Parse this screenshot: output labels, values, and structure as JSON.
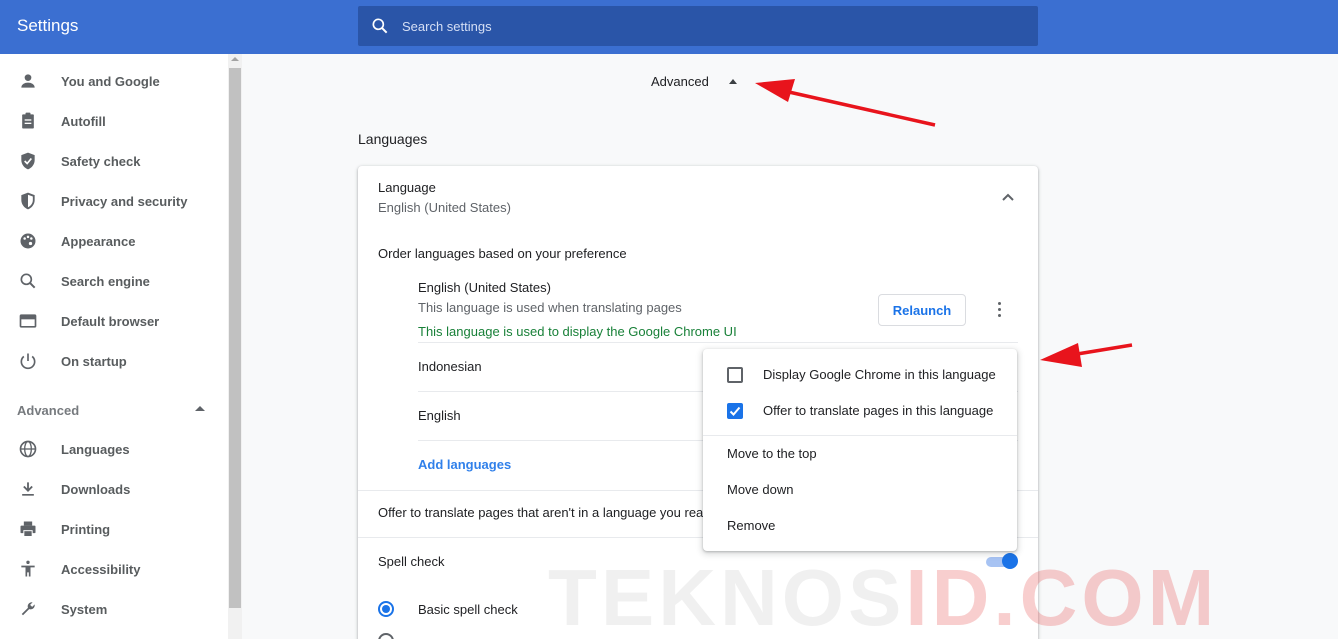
{
  "header": {
    "title": "Settings",
    "search_placeholder": "Search settings"
  },
  "sidebar": {
    "items": [
      {
        "label": "You and Google",
        "icon": "person-icon"
      },
      {
        "label": "Autofill",
        "icon": "clipboard-icon"
      },
      {
        "label": "Safety check",
        "icon": "shield-check-icon"
      },
      {
        "label": "Privacy and security",
        "icon": "shield-icon"
      },
      {
        "label": "Appearance",
        "icon": "palette-icon"
      },
      {
        "label": "Search engine",
        "icon": "search-icon"
      },
      {
        "label": "Default browser",
        "icon": "browser-icon"
      },
      {
        "label": "On startup",
        "icon": "power-icon"
      }
    ],
    "advanced_label": "Advanced",
    "advanced_items": [
      {
        "label": "Languages",
        "icon": "globe-icon"
      },
      {
        "label": "Downloads",
        "icon": "download-icon"
      },
      {
        "label": "Printing",
        "icon": "printer-icon"
      },
      {
        "label": "Accessibility",
        "icon": "accessibility-icon"
      },
      {
        "label": "System",
        "icon": "wrench-icon"
      }
    ]
  },
  "main": {
    "advanced_toggle": "Advanced",
    "section_title": "Languages",
    "language_label": "Language",
    "language_value": "English (United States)",
    "order_label": "Order languages based on your preference",
    "languages": [
      {
        "name": "English (United States)",
        "note1": "This language is used when translating pages",
        "note2": "This language is used to display the Google Chrome UI"
      },
      {
        "name": "Indonesian"
      },
      {
        "name": "English"
      }
    ],
    "relaunch_label": "Relaunch",
    "add_languages": "Add languages",
    "offer_translate": "Offer to translate pages that aren't in a language you read",
    "spell_check": "Spell check",
    "spell_check_enabled": true,
    "basic_spell_check": "Basic spell check"
  },
  "menu": {
    "display_chrome": "Display Google Chrome in this language",
    "display_chrome_checked": false,
    "offer_translate": "Offer to translate pages in this language",
    "offer_translate_checked": true,
    "move_top": "Move to the top",
    "move_down": "Move down",
    "remove": "Remove"
  },
  "watermark": {
    "part1": "TEKNOS",
    "part2": "ID.COM"
  },
  "colors": {
    "header": "#3b6fd1",
    "accent": "#1a73e8",
    "annotation_arrow": "#e8141c"
  }
}
